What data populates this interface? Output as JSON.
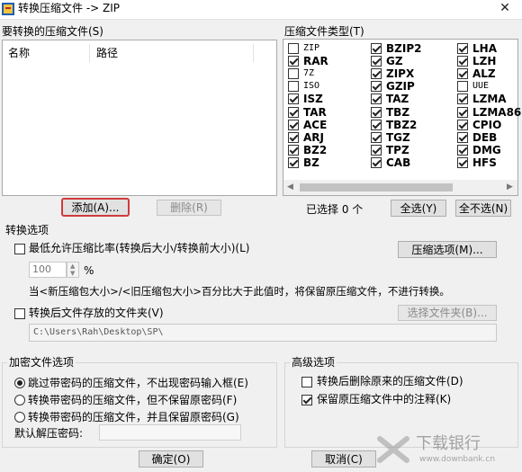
{
  "window": {
    "title": "转换压缩文件 -> ZIP",
    "close_glyph": "✕"
  },
  "files": {
    "label": "要转换的压缩文件(S)",
    "columns": [
      "名称",
      "路径"
    ],
    "add_button": "添加(A)...",
    "delete_button": "删除(R)"
  },
  "types": {
    "label": "压缩文件类型(T)",
    "items": [
      {
        "label": "ZIP",
        "checked": false,
        "bold": false
      },
      {
        "label": "RAR",
        "checked": true,
        "bold": true
      },
      {
        "label": "7Z",
        "checked": false,
        "bold": false
      },
      {
        "label": "ISO",
        "checked": false,
        "bold": false
      },
      {
        "label": "ISZ",
        "checked": true,
        "bold": true
      },
      {
        "label": "TAR",
        "checked": true,
        "bold": true
      },
      {
        "label": "ACE",
        "checked": true,
        "bold": true
      },
      {
        "label": "ARJ",
        "checked": true,
        "bold": true
      },
      {
        "label": "BZ2",
        "checked": true,
        "bold": true
      },
      {
        "label": "BZ",
        "checked": true,
        "bold": true
      },
      {
        "label": "BZIP2",
        "checked": true,
        "bold": true
      },
      {
        "label": "GZ",
        "checked": true,
        "bold": true
      },
      {
        "label": "ZIPX",
        "checked": true,
        "bold": true
      },
      {
        "label": "GZIP",
        "checked": true,
        "bold": true
      },
      {
        "label": "TAZ",
        "checked": true,
        "bold": true
      },
      {
        "label": "TBZ",
        "checked": true,
        "bold": true
      },
      {
        "label": "TBZ2",
        "checked": true,
        "bold": true
      },
      {
        "label": "TGZ",
        "checked": true,
        "bold": true
      },
      {
        "label": "TPZ",
        "checked": true,
        "bold": true
      },
      {
        "label": "CAB",
        "checked": true,
        "bold": true
      },
      {
        "label": "LHA",
        "checked": true,
        "bold": true
      },
      {
        "label": "LZH",
        "checked": true,
        "bold": true
      },
      {
        "label": "ALZ",
        "checked": true,
        "bold": true
      },
      {
        "label": "UUE",
        "checked": false,
        "bold": false
      },
      {
        "label": "LZMA",
        "checked": true,
        "bold": true
      },
      {
        "label": "LZMA86",
        "checked": true,
        "bold": true
      },
      {
        "label": "CPIO",
        "checked": true,
        "bold": true
      },
      {
        "label": "DEB",
        "checked": true,
        "bold": true
      },
      {
        "label": "DMG",
        "checked": true,
        "bold": true
      },
      {
        "label": "HFS",
        "checked": true,
        "bold": true
      }
    ],
    "selected_count_text": "已选择 0 个",
    "select_all_button": "全选(Y)",
    "select_none_button": "全不选(N)"
  },
  "convert_options": {
    "label": "转换选项",
    "min_ratio_label": "最低允许压缩比率(转换后大小/转换前大小)(L)",
    "min_ratio_checked": false,
    "ratio_value": "100",
    "ratio_unit": "%",
    "compress_options_button": "压缩选项(M)...",
    "ratio_hint": "当<新压缩包大小>/<旧压缩包大小>百分比大于此值时，将保留原压缩文件，不进行转换。",
    "output_folder_label": "转换后文件存放的文件夹(V)",
    "output_folder_checked": false,
    "select_folder_button": "选择文件夹(B)...",
    "output_path": "C:\\Users\\Rah\\Desktop\\SP\\"
  },
  "encryption": {
    "label": "加密文件选项",
    "options": [
      {
        "label": "跳过带密码的压缩文件，不出现密码输入框(E)",
        "selected": true
      },
      {
        "label": "转换带密码的压缩文件，但不保留原密码(F)",
        "selected": false
      },
      {
        "label": "转换带密码的压缩文件，并且保留原密码(G)",
        "selected": false
      }
    ],
    "default_password_label": "默认解压密码:",
    "default_password_value": ""
  },
  "advanced": {
    "label": "高级选项",
    "delete_original_label": "转换后删除原来的压缩文件(D)",
    "delete_original_checked": false,
    "keep_comment_label": "保留原压缩文件中的注释(K)",
    "keep_comment_checked": true
  },
  "footer": {
    "ok_button": "确定(O)",
    "cancel_button": "取消(C)"
  },
  "watermark": {
    "text": "下载银行",
    "url_text": "www.downbank.cn"
  }
}
